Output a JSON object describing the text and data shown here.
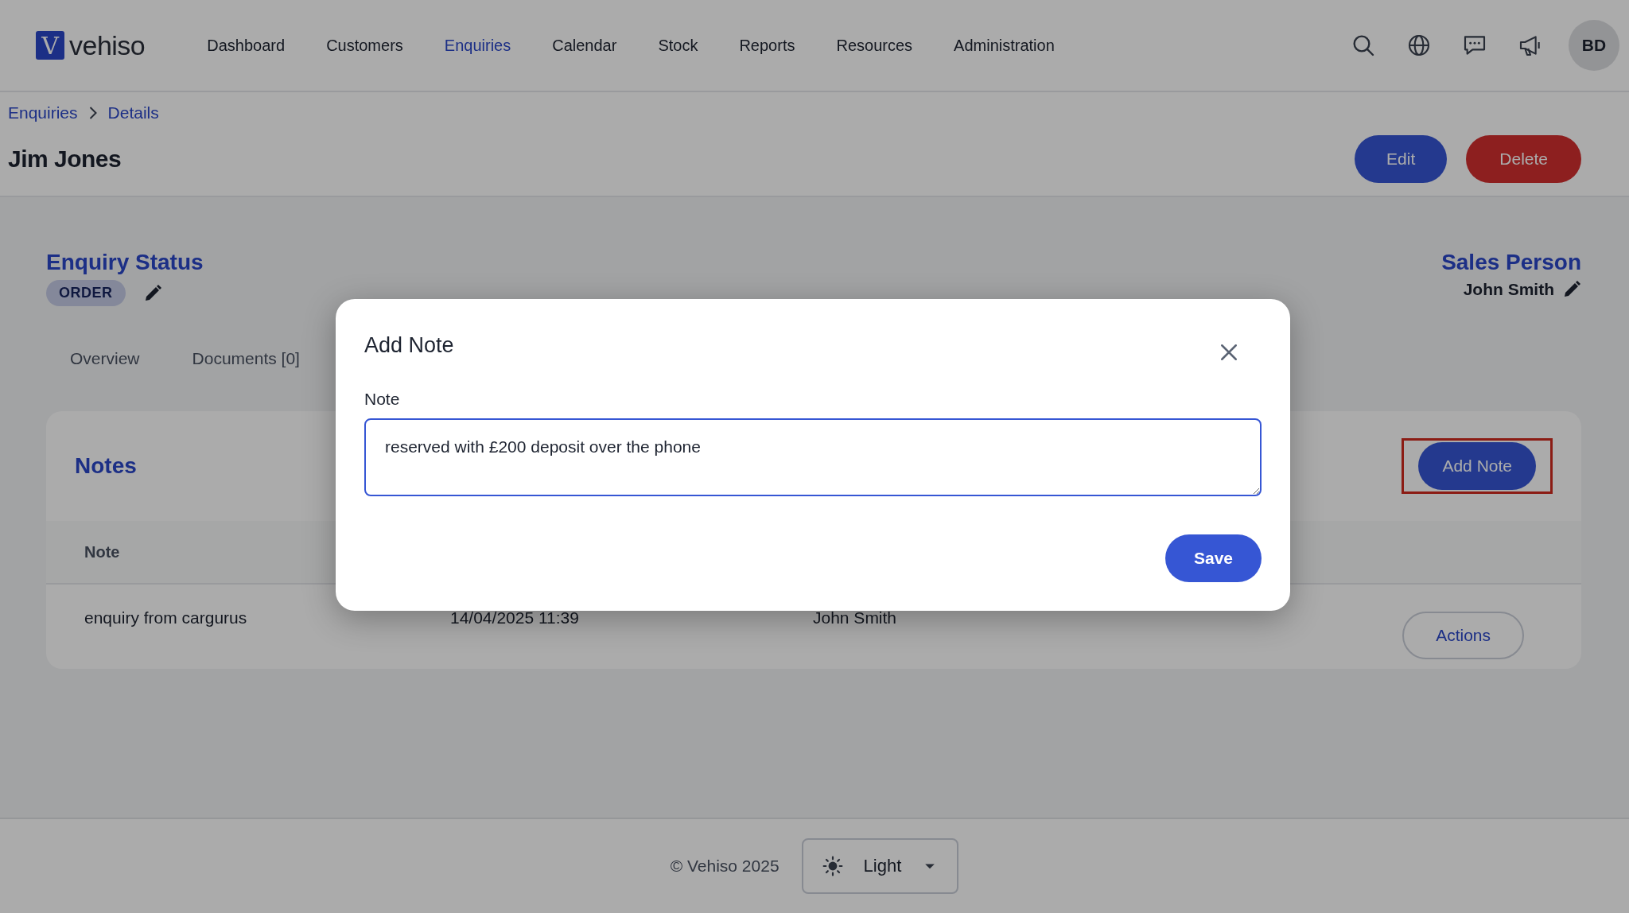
{
  "app": {
    "logo_letter": "V",
    "logo_text": "vehiso"
  },
  "nav": [
    {
      "label": "Dashboard",
      "selected": false
    },
    {
      "label": "Customers",
      "selected": false
    },
    {
      "label": "Enquiries",
      "selected": true
    },
    {
      "label": "Calendar",
      "selected": false
    },
    {
      "label": "Stock",
      "selected": false
    },
    {
      "label": "Reports",
      "selected": false
    },
    {
      "label": "Resources",
      "selected": false
    },
    {
      "label": "Administration",
      "selected": false
    }
  ],
  "toolbar": [
    {
      "kind": "search"
    },
    {
      "kind": "globe"
    },
    {
      "kind": "chat"
    },
    {
      "kind": "megaphone"
    }
  ],
  "avatar": {
    "initials": "BD"
  },
  "breadcrumb": [
    "Enquiries",
    "Details"
  ],
  "page_title": "Jim Jones",
  "header_buttons": [
    {
      "label": "Edit",
      "kind": "primary"
    },
    {
      "label": "Delete",
      "kind": "danger"
    }
  ],
  "enquiry_status": {
    "heading": "Enquiry Status",
    "badge": "ORDER"
  },
  "sales_person": {
    "heading": "Sales Person",
    "name": "John Smith"
  },
  "tabs": [
    {
      "label": "Overview",
      "selected": false
    },
    {
      "label": "Documents [0]",
      "selected": false
    }
  ],
  "notes": {
    "title": "Notes",
    "add_button": "Add Note",
    "highlighted": true,
    "columns": [
      "Note"
    ],
    "rows": [
      {
        "cells": [
          "enquiry from cargurus",
          "14/04/2025 11:39",
          "John Smith"
        ],
        "action": "Actions"
      }
    ]
  },
  "modal": {
    "title": "Add Note",
    "field_label": "Note",
    "value": "reserved with £200 deposit over the phone",
    "save": "Save"
  },
  "footer": {
    "copyright": "© Vehiso 2025",
    "theme": "Light"
  }
}
